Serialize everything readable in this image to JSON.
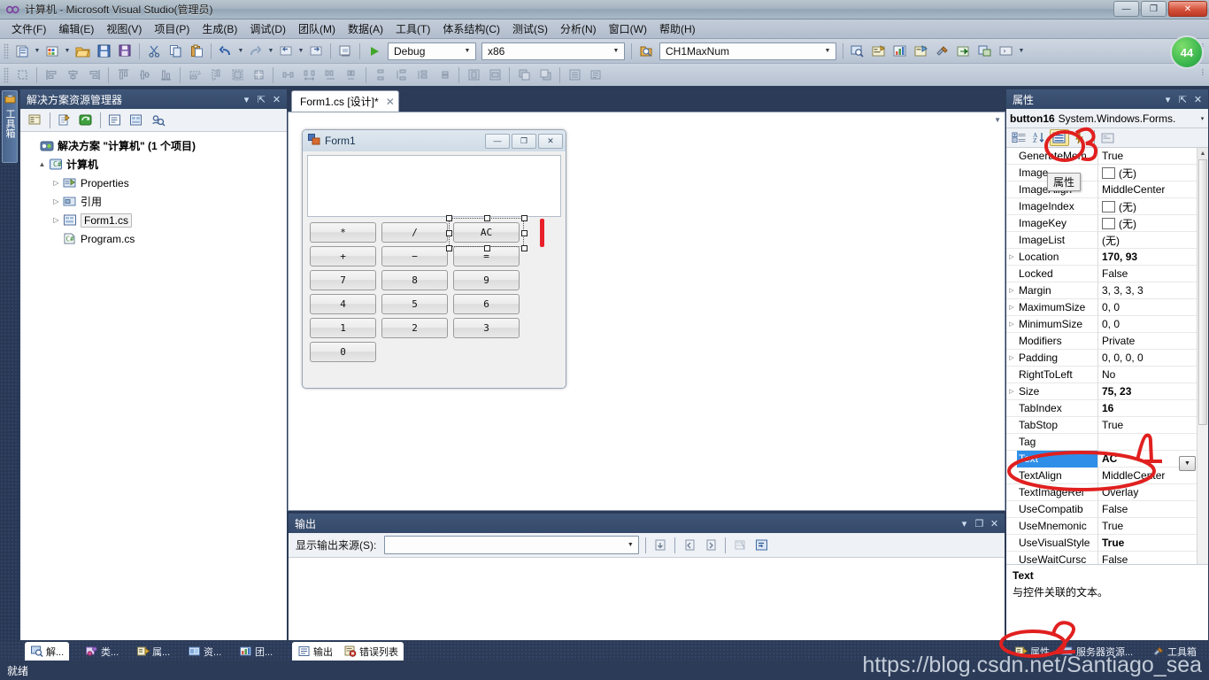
{
  "window": {
    "title": "计算机 - Microsoft Visual Studio(管理员)",
    "minimize": "—",
    "maximize": "❐",
    "close": "✕",
    "notification_count": "44"
  },
  "menubar": {
    "items": [
      {
        "label": "文件(F)"
      },
      {
        "label": "编辑(E)"
      },
      {
        "label": "视图(V)"
      },
      {
        "label": "项目(P)"
      },
      {
        "label": "生成(B)"
      },
      {
        "label": "调试(D)"
      },
      {
        "label": "团队(M)"
      },
      {
        "label": "数据(A)"
      },
      {
        "label": "工具(T)"
      },
      {
        "label": "体系结构(C)"
      },
      {
        "label": "测试(S)"
      },
      {
        "label": "分析(N)"
      },
      {
        "label": "窗口(W)"
      },
      {
        "label": "帮助(H)"
      }
    ]
  },
  "toolbar": {
    "run_label": "▶",
    "config_combo": "Debug",
    "platform_combo": "x86",
    "startup_combo": "CH1MaxNum"
  },
  "leftrail": {
    "toolbox_tab": "工具箱"
  },
  "solution_explorer": {
    "title": "解决方案资源管理器",
    "dropdown": "▾",
    "pin": "⇱",
    "close": "✕",
    "tree": [
      {
        "label": "解决方案 \"计算机\" (1 个项目)",
        "icon": "solution-icon",
        "depth": 0,
        "expander": "",
        "bold": true,
        "selected": false
      },
      {
        "label": "计算机",
        "icon": "csharp-project-icon",
        "depth": 1,
        "expander": "▲",
        "bold": true,
        "selected": false
      },
      {
        "label": "Properties",
        "icon": "properties-folder-icon",
        "depth": 2,
        "expander": "▷",
        "bold": false,
        "selected": false
      },
      {
        "label": "引用",
        "icon": "references-icon",
        "depth": 2,
        "expander": "▷",
        "bold": false,
        "selected": false
      },
      {
        "label": "Form1.cs",
        "icon": "form-file-icon",
        "depth": 2,
        "expander": "▷",
        "bold": false,
        "selected": true
      },
      {
        "label": "Program.cs",
        "icon": "csharp-file-icon",
        "depth": 2,
        "expander": "",
        "bold": false,
        "selected": false
      }
    ]
  },
  "document": {
    "tab_label": "Form1.cs [设计]*",
    "tab_close": "✕"
  },
  "form_designer": {
    "form_title": "Form1",
    "form_min": "—",
    "form_max": "❐",
    "form_close": "✕",
    "textbox_value": "",
    "buttons": [
      [
        "*",
        "/",
        "AC"
      ],
      [
        "+",
        "−",
        "="
      ],
      [
        "7",
        "8",
        "9"
      ],
      [
        "4",
        "5",
        "6"
      ],
      [
        "1",
        "2",
        "3"
      ],
      [
        "0"
      ]
    ],
    "selected_button": "AC"
  },
  "output_panel": {
    "title": "输出",
    "dropdown": "▾",
    "float": "❐",
    "close": "✕",
    "source_label": "显示输出来源(S):",
    "source_value": "",
    "body_text": ""
  },
  "properties_panel": {
    "title": "属性",
    "dropdown": "▾",
    "pin": "⇱",
    "close": "✕",
    "object_name": "button16",
    "object_type": "System.Windows.Forms.",
    "object_arrow": "▾",
    "tooltip": "属性",
    "rows": [
      {
        "expander": "",
        "name": "GenerateMem",
        "value": "True",
        "bold": false,
        "swatch": false,
        "selected": false
      },
      {
        "expander": "",
        "name": "Image",
        "value": "(无)",
        "bold": false,
        "swatch": true,
        "selected": false
      },
      {
        "expander": "",
        "name": "ImageAlign",
        "value": "MiddleCenter",
        "bold": false,
        "swatch": false,
        "selected": false
      },
      {
        "expander": "",
        "name": "ImageIndex",
        "value": "(无)",
        "bold": false,
        "swatch": true,
        "selected": false
      },
      {
        "expander": "",
        "name": "ImageKey",
        "value": "(无)",
        "bold": false,
        "swatch": true,
        "selected": false
      },
      {
        "expander": "",
        "name": "ImageList",
        "value": "(无)",
        "bold": false,
        "swatch": false,
        "selected": false
      },
      {
        "expander": "▷",
        "name": "Location",
        "value": "170, 93",
        "bold": true,
        "swatch": false,
        "selected": false
      },
      {
        "expander": "",
        "name": "Locked",
        "value": "False",
        "bold": false,
        "swatch": false,
        "selected": false
      },
      {
        "expander": "▷",
        "name": "Margin",
        "value": "3, 3, 3, 3",
        "bold": false,
        "swatch": false,
        "selected": false
      },
      {
        "expander": "▷",
        "name": "MaximumSize",
        "value": "0, 0",
        "bold": false,
        "swatch": false,
        "selected": false
      },
      {
        "expander": "▷",
        "name": "MinimumSize",
        "value": "0, 0",
        "bold": false,
        "swatch": false,
        "selected": false
      },
      {
        "expander": "",
        "name": "Modifiers",
        "value": "Private",
        "bold": false,
        "swatch": false,
        "selected": false
      },
      {
        "expander": "▷",
        "name": "Padding",
        "value": "0, 0, 0, 0",
        "bold": false,
        "swatch": false,
        "selected": false
      },
      {
        "expander": "",
        "name": "RightToLeft",
        "value": "No",
        "bold": false,
        "swatch": false,
        "selected": false
      },
      {
        "expander": "▷",
        "name": "Size",
        "value": "75, 23",
        "bold": true,
        "swatch": false,
        "selected": false
      },
      {
        "expander": "",
        "name": "TabIndex",
        "value": "16",
        "bold": true,
        "swatch": false,
        "selected": false
      },
      {
        "expander": "",
        "name": "TabStop",
        "value": "True",
        "bold": false,
        "swatch": false,
        "selected": false
      },
      {
        "expander": "",
        "name": "Tag",
        "value": "",
        "bold": false,
        "swatch": false,
        "selected": false
      },
      {
        "expander": "",
        "name": "Text",
        "value": "AC",
        "bold": true,
        "swatch": false,
        "selected": true
      },
      {
        "expander": "",
        "name": "TextAlign",
        "value": "MiddleCenter",
        "bold": false,
        "swatch": false,
        "selected": false
      },
      {
        "expander": "",
        "name": "TextImageRel",
        "value": "Overlay",
        "bold": false,
        "swatch": false,
        "selected": false
      },
      {
        "expander": "",
        "name": "UseCompatib",
        "value": "False",
        "bold": false,
        "swatch": false,
        "selected": false
      },
      {
        "expander": "",
        "name": "UseMnemonic",
        "value": "True",
        "bold": false,
        "swatch": false,
        "selected": false
      },
      {
        "expander": "",
        "name": "UseVisualStyle",
        "value": "True",
        "bold": true,
        "swatch": false,
        "selected": false
      },
      {
        "expander": "",
        "name": "UseWaitCursc",
        "value": "False",
        "bold": false,
        "swatch": false,
        "selected": false
      }
    ],
    "description_title": "Text",
    "description_body": "与控件关联的文本。"
  },
  "bottom_tabs": [
    {
      "label": "解...",
      "icon": "solution-explorer-icon",
      "active": true
    },
    {
      "label": "类...",
      "icon": "class-view-icon",
      "active": false
    },
    {
      "label": "属...",
      "icon": "properties-icon",
      "active": false
    },
    {
      "label": "资...",
      "icon": "resource-view-icon",
      "active": false
    },
    {
      "label": "团...",
      "icon": "team-explorer-icon",
      "active": false
    }
  ],
  "output_tabs": [
    {
      "label": "输出",
      "icon": "output-icon",
      "active": true
    },
    {
      "label": "错误列表",
      "icon": "error-list-icon",
      "active": false
    }
  ],
  "properties_bottom_tabs": [
    {
      "label": "属性",
      "icon": "properties-icon",
      "active": true
    },
    {
      "label": "服务器资源...",
      "icon": "server-explorer-icon",
      "active": false
    },
    {
      "label": "工具箱",
      "icon": "toolbox-icon",
      "active": false
    }
  ],
  "statusbar": {
    "text": "就绪"
  },
  "watermark": {
    "text": "https://blog.csdn.net/Santiago_sea"
  },
  "annotations": {
    "marker_3": "3",
    "marker_2": "2",
    "marker_1": "1"
  }
}
